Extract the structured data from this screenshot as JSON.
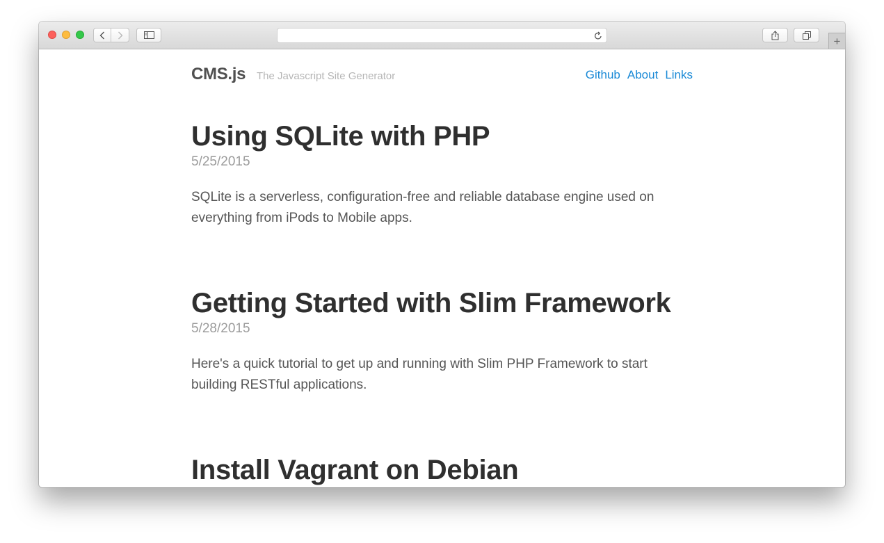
{
  "browser": {
    "address_text": "",
    "icons": {
      "back": "chevron-left-icon",
      "forward": "chevron-right-icon",
      "sidebar": "sidebar-icon",
      "reload": "reload-icon",
      "share": "share-icon",
      "tabs": "tabs-overview-icon",
      "new_tab": "plus-icon"
    },
    "new_tab_symbol": "+"
  },
  "site": {
    "title": "CMS.js",
    "tagline": "The Javascript Site Generator",
    "nav": [
      "Github",
      "About",
      "Links"
    ],
    "colors": {
      "link": "#1989d6",
      "title": "#2f2f2f",
      "date": "#9b9b9b",
      "body": "#555555"
    }
  },
  "posts": [
    {
      "title": "Using SQLite with PHP",
      "date": "5/25/2015",
      "excerpt": "SQLite is a serverless, configuration-free and reliable database engine used on everything from iPods to Mobile apps."
    },
    {
      "title": "Getting Started with Slim Framework",
      "date": "5/28/2015",
      "excerpt": "Here's a quick tutorial to get up and running with Slim PHP Framework to start building RESTful applications."
    },
    {
      "title": "Install Vagrant on Debian"
    }
  ],
  "window_controls": {
    "close_color": "#fc605c",
    "minimize_color": "#fdbc40",
    "zoom_color": "#34c84a"
  }
}
